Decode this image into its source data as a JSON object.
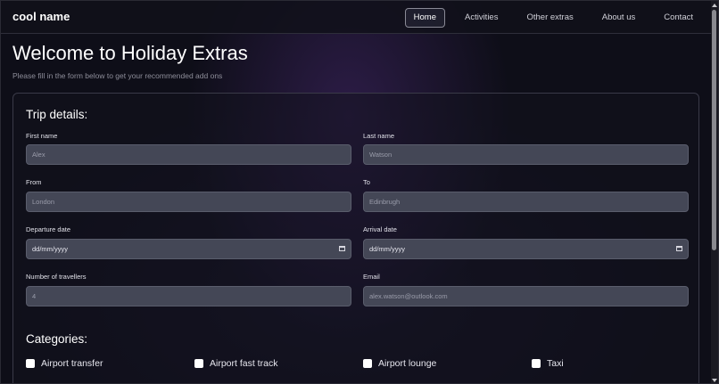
{
  "nav": {
    "brand": "cool name",
    "items": [
      "Home",
      "Activities",
      "Other extras",
      "About us",
      "Contact"
    ],
    "active": "Home"
  },
  "header": {
    "title": "Welcome to Holiday Extras",
    "subtitle": "Please fill in the form below to get your recommended add ons"
  },
  "form": {
    "title": "Trip details:",
    "first_name": {
      "label": "First name",
      "placeholder": "Alex"
    },
    "last_name": {
      "label": "Last name",
      "placeholder": "Watson"
    },
    "from": {
      "label": "From",
      "placeholder": "London"
    },
    "to": {
      "label": "To",
      "placeholder": "Edinbrugh"
    },
    "departure": {
      "label": "Departure date",
      "value": "dd/mm/yyyy"
    },
    "arrival": {
      "label": "Arrival date",
      "value": "dd/mm/yyyy"
    },
    "travellers": {
      "label": "Number of travellers",
      "placeholder": "4"
    },
    "email": {
      "label": "Email",
      "placeholder": "alex.watson@outlook.com"
    }
  },
  "categories": {
    "title": "Categories:",
    "items": [
      "Airport transfer",
      "Airport fast track",
      "Airport lounge",
      "Taxi"
    ]
  },
  "colors": {
    "background": "#0e0e18",
    "input_bg": "#444756",
    "accent_glow": "#46286e"
  },
  "icons": [
    "calendar-icon",
    "checkbox"
  ]
}
